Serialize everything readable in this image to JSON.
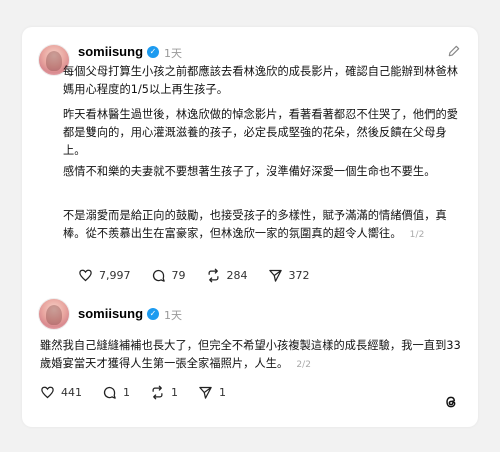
{
  "posts": [
    {
      "username": "somiisung",
      "verified": true,
      "time": "1天",
      "paragraphs": [
        "每個父母打算生小孩之前都應該去看林逸欣的成長影片，確認自己能辦到林爸林媽用心程度的1/5以上再生孩子。",
        "昨天看林醫生過世後，林逸欣做的悼念影片，看著看著都忍不住哭了，他們的愛都是雙向的，用心灌溉滋養的孩子，必定長成堅強的花朵，然後反饋在父母身上。",
        "感情不和樂的夫妻就不要想著生孩子了，沒準備好深愛一個生命也不要生。",
        "不是溺愛而是給正向的鼓勵，也接受孩子的多樣性，賦予滿滿的情緒價值，真棒。從不羨慕出生在富豪家，但林逸欣一家的氛圍真的超令人嚮往。"
      ],
      "page_tag": "1/2",
      "stats": {
        "likes": "7,997",
        "comments": "79",
        "reposts": "284",
        "shares": "372"
      }
    },
    {
      "username": "somiisung",
      "verified": true,
      "time": "1天",
      "paragraphs": [
        "雖然我自己縫縫補補也長大了，但完全不希望小孩複製這樣的成長經驗，我一直到33歲婚宴當天才獲得人生第一張全家福照片，人生。"
      ],
      "page_tag": "2/2",
      "stats": {
        "likes": "441",
        "comments": "1",
        "reposts": "1",
        "shares": "1"
      }
    }
  ],
  "icons": {
    "edit": "pencil-icon",
    "like": "heart-icon",
    "comment": "comment-icon",
    "repost": "repost-icon",
    "share": "send-icon",
    "logo": "threads-logo-icon",
    "verified": "verified-badge-icon"
  },
  "colors": {
    "verified": "#1d9bf0",
    "background": "#f2f2f2",
    "card": "#ffffff"
  }
}
